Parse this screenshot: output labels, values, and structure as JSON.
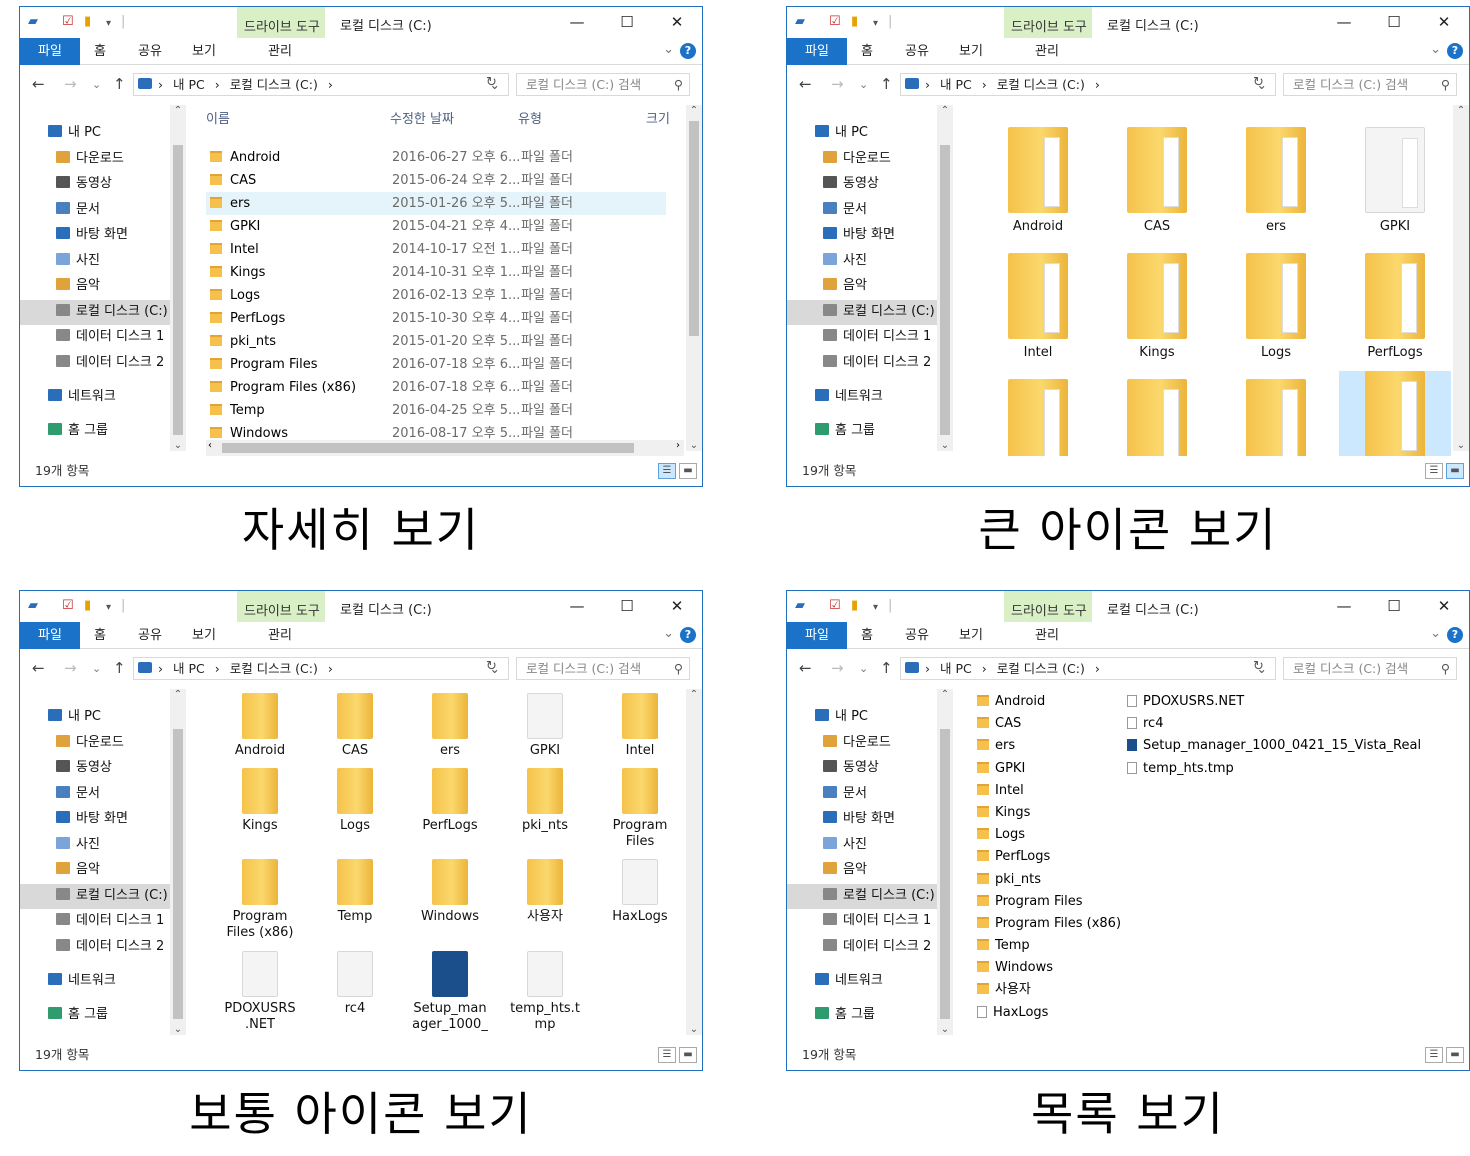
{
  "window": {
    "context_tab": "드라이브 도구",
    "title": "로컬 디스크 (C:)",
    "minimize": "—",
    "maximize": "☐",
    "close": "✕"
  },
  "ribbon": {
    "file": "파일",
    "home": "홈",
    "share": "공유",
    "view": "보기",
    "manage": "관리",
    "help": "?"
  },
  "address": {
    "path_pc": "내 PC",
    "path_drive": "로컬 디스크 (C:)",
    "sep": "›",
    "search_placeholder": "로컬 디스크 (C:) 검색"
  },
  "nav_pane": [
    {
      "label": "내 PC",
      "icon": "pc-icon"
    },
    {
      "label": "다운로드",
      "icon": "download-folder-icon"
    },
    {
      "label": "동영상",
      "icon": "video-folder-icon"
    },
    {
      "label": "문서",
      "icon": "documents-folder-icon"
    },
    {
      "label": "바탕 화면",
      "icon": "desktop-folder-icon"
    },
    {
      "label": "사진",
      "icon": "pictures-folder-icon"
    },
    {
      "label": "음악",
      "icon": "music-folder-icon"
    },
    {
      "label": "로컬 디스크 (C:)",
      "icon": "drive-icon"
    },
    {
      "label": "데이터 디스크 1",
      "icon": "drive-icon"
    },
    {
      "label": "데이터 디스크 2",
      "icon": "drive-icon"
    },
    {
      "label": "네트워크",
      "icon": "network-icon"
    },
    {
      "label": "홈 그룹",
      "icon": "homegroup-icon"
    }
  ],
  "status": "19개 항목",
  "captions": [
    "자세히 보기",
    "큰 아이콘 보기",
    "보통 아이콘 보기",
    "목록 보기"
  ],
  "details": {
    "headers": [
      "이름",
      "수정한 날짜",
      "유형",
      "크기"
    ],
    "rows": [
      {
        "name": "Android",
        "date": "2016-06-27 오후 6...",
        "type": "파일 폴더"
      },
      {
        "name": "CAS",
        "date": "2015-06-24 오후 2...",
        "type": "파일 폴더"
      },
      {
        "name": "ers",
        "date": "2015-01-26 오후 5...",
        "type": "파일 폴더"
      },
      {
        "name": "GPKI",
        "date": "2015-04-21 오후 4...",
        "type": "파일 폴더"
      },
      {
        "name": "Intel",
        "date": "2014-10-17 오전 1...",
        "type": "파일 폴더"
      },
      {
        "name": "Kings",
        "date": "2014-10-31 오후 1...",
        "type": "파일 폴더"
      },
      {
        "name": "Logs",
        "date": "2016-02-13 오후 1...",
        "type": "파일 폴더"
      },
      {
        "name": "PerfLogs",
        "date": "2015-10-30 오후 4...",
        "type": "파일 폴더"
      },
      {
        "name": "pki_nts",
        "date": "2015-01-20 오후 5...",
        "type": "파일 폴더"
      },
      {
        "name": "Program Files",
        "date": "2016-07-18 오후 6...",
        "type": "파일 폴더"
      },
      {
        "name": "Program Files (x86)",
        "date": "2016-07-18 오후 6...",
        "type": "파일 폴더"
      },
      {
        "name": "Temp",
        "date": "2016-04-25 오후 5...",
        "type": "파일 폴더"
      },
      {
        "name": "Windows",
        "date": "2016-08-17 오후 5...",
        "type": "파일 폴더"
      }
    ]
  },
  "large_icons": [
    "Android",
    "CAS",
    "ers",
    "GPKI",
    "Intel",
    "Kings",
    "Logs",
    "PerfLogs"
  ],
  "medium_icons": [
    [
      "Android"
    ],
    [
      "CAS"
    ],
    [
      "ers"
    ],
    [
      "GPKI"
    ],
    [
      "Intel"
    ],
    [
      "Kings"
    ],
    [
      "Logs"
    ],
    [
      "PerfLogs"
    ],
    [
      "pki_nts"
    ],
    [
      "Program",
      "Files"
    ],
    [
      "Program",
      "Files (x86)"
    ],
    [
      "Temp"
    ],
    [
      "Windows"
    ],
    [
      "사용자"
    ],
    [
      "HaxLogs"
    ],
    [
      "PDOXUSRS",
      ".NET"
    ],
    [
      "rc4"
    ],
    [
      "Setup_man",
      "ager_1000_"
    ],
    [
      "temp_hts.t",
      "mp"
    ]
  ],
  "list": {
    "col1": [
      "Android",
      "CAS",
      "ers",
      "GPKI",
      "Intel",
      "Kings",
      "Logs",
      "PerfLogs",
      "pki_nts",
      "Program Files",
      "Program Files (x86)",
      "Temp",
      "Windows",
      "사용자",
      "HaxLogs"
    ],
    "col2": [
      "PDOXUSRS.NET",
      "rc4",
      "Setup_manager_1000_0421_15_Vista_Real",
      "temp_hts.tmp"
    ]
  }
}
